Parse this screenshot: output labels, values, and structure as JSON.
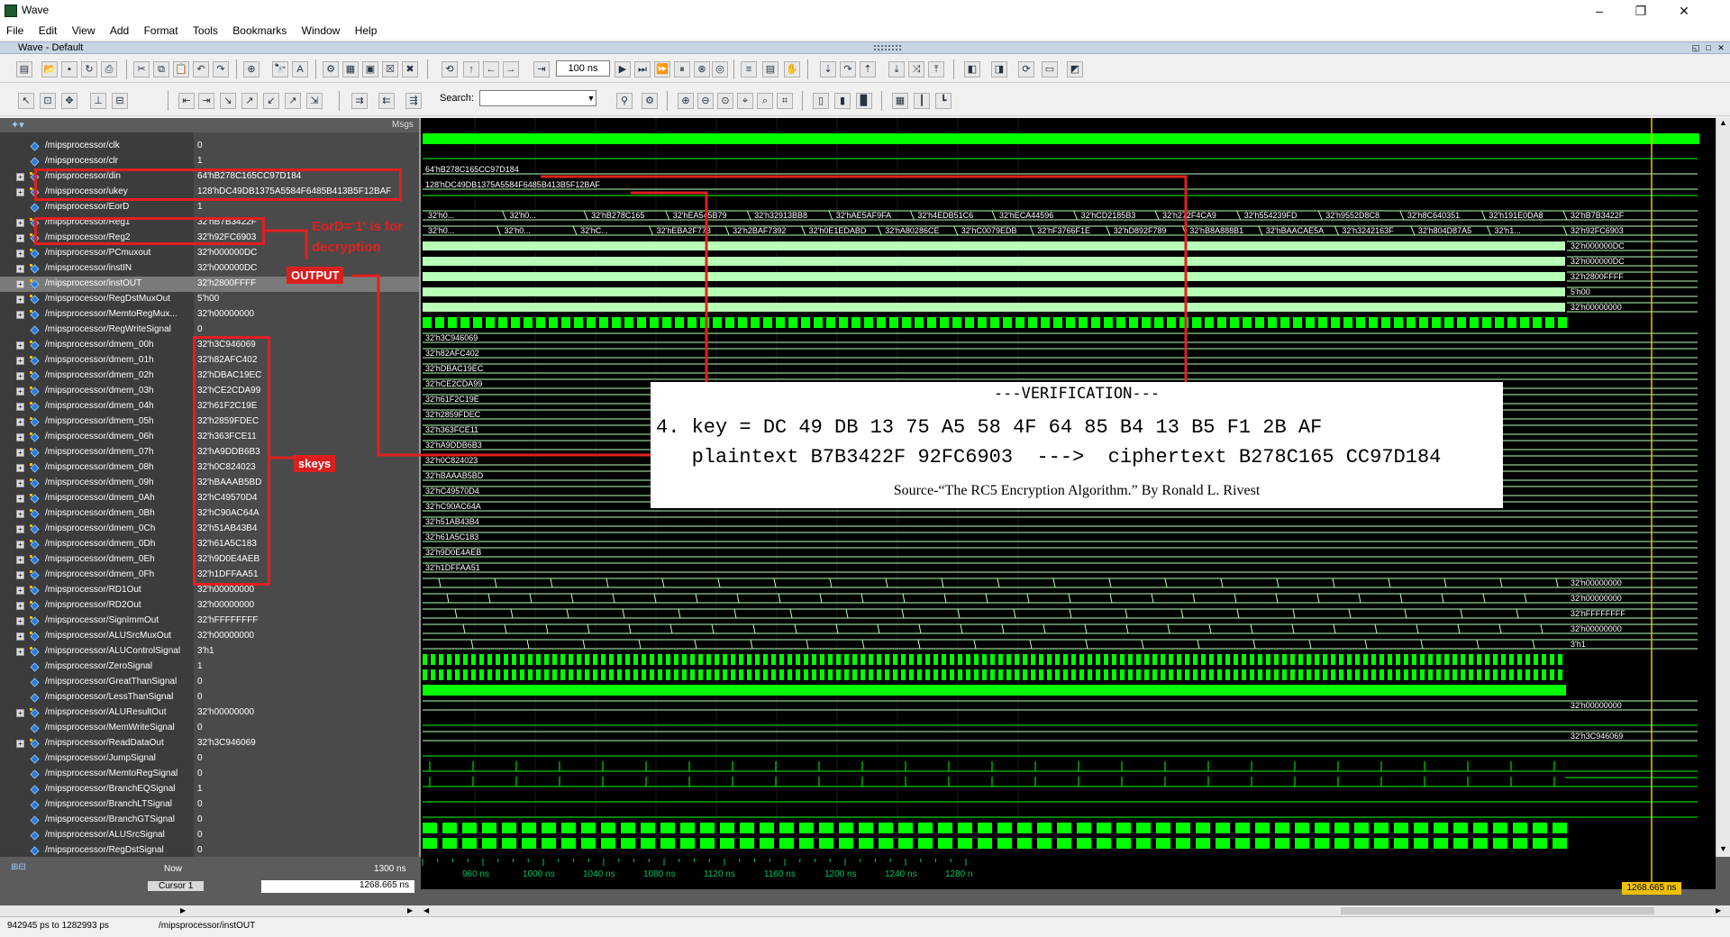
{
  "window": {
    "app_title": "Wave",
    "minimize": "–",
    "restore": "❐",
    "close": "✕"
  },
  "menu": [
    "File",
    "Edit",
    "View",
    "Add",
    "Format",
    "Tools",
    "Bookmarks",
    "Window",
    "Help"
  ],
  "pane": {
    "title": "Wave - Default",
    "msgs_label": "Msgs"
  },
  "toolbar": {
    "zoom_value": "100 ns",
    "search_label": "Search:",
    "search_value": ""
  },
  "signals": [
    {
      "name": "/mipsprocessor/clk",
      "value": "0",
      "expandable": false
    },
    {
      "name": "/mipsprocessor/clr",
      "value": "1",
      "expandable": false
    },
    {
      "name": "/mipsprocessor/din",
      "value": "64'hB278C165CC97D184",
      "expandable": true
    },
    {
      "name": "/mipsprocessor/ukey",
      "value": "128'hDC49DB1375A5584F6485B413B5F12BAF",
      "expandable": true
    },
    {
      "name": "/mipsprocessor/EorD",
      "value": "1",
      "expandable": false
    },
    {
      "name": "/mipsprocessor/Reg1",
      "value": "32'hB7B3422F",
      "expandable": true
    },
    {
      "name": "/mipsprocessor/Reg2",
      "value": "32'h92FC6903",
      "expandable": true
    },
    {
      "name": "/mipsprocessor/PCmuxout",
      "value": "32'h000000DC",
      "expandable": true
    },
    {
      "name": "/mipsprocessor/instIN",
      "value": "32'h000000DC",
      "expandable": true
    },
    {
      "name": "/mipsprocessor/instOUT",
      "value": "32'h2800FFFF",
      "expandable": true
    },
    {
      "name": "/mipsprocessor/RegDstMuxOut",
      "value": "5'h00",
      "expandable": true
    },
    {
      "name": "/mipsprocessor/MemtoRegMux...",
      "value": "32'h00000000",
      "expandable": true
    },
    {
      "name": "/mipsprocessor/RegWriteSignal",
      "value": "0",
      "expandable": false
    },
    {
      "name": "/mipsprocessor/dmem_00h",
      "value": "32'h3C946069",
      "expandable": true
    },
    {
      "name": "/mipsprocessor/dmem_01h",
      "value": "32'h82AFC402",
      "expandable": true
    },
    {
      "name": "/mipsprocessor/dmem_02h",
      "value": "32'hDBAC19EC",
      "expandable": true
    },
    {
      "name": "/mipsprocessor/dmem_03h",
      "value": "32'hCE2CDA99",
      "expandable": true
    },
    {
      "name": "/mipsprocessor/dmem_04h",
      "value": "32'h61F2C19E",
      "expandable": true
    },
    {
      "name": "/mipsprocessor/dmem_05h",
      "value": "32'h2859FDEC",
      "expandable": true
    },
    {
      "name": "/mipsprocessor/dmem_06h",
      "value": "32'h363FCE11",
      "expandable": true
    },
    {
      "name": "/mipsprocessor/dmem_07h",
      "value": "32'hA9DDB6B3",
      "expandable": true
    },
    {
      "name": "/mipsprocessor/dmem_08h",
      "value": "32'h0C824023",
      "expandable": true
    },
    {
      "name": "/mipsprocessor/dmem_09h",
      "value": "32'hBAAAB5BD",
      "expandable": true
    },
    {
      "name": "/mipsprocessor/dmem_0Ah",
      "value": "32'hC49570D4",
      "expandable": true
    },
    {
      "name": "/mipsprocessor/dmem_0Bh",
      "value": "32'hC90AC64A",
      "expandable": true
    },
    {
      "name": "/mipsprocessor/dmem_0Ch",
      "value": "32'h51AB43B4",
      "expandable": true
    },
    {
      "name": "/mipsprocessor/dmem_0Dh",
      "value": "32'h61A5C183",
      "expandable": true
    },
    {
      "name": "/mipsprocessor/dmem_0Eh",
      "value": "32'h9D0E4AEB",
      "expandable": true
    },
    {
      "name": "/mipsprocessor/dmem_0Fh",
      "value": "32'h1DFFAA51",
      "expandable": true
    },
    {
      "name": "/mipsprocessor/RD1Out",
      "value": "32'h00000000",
      "expandable": true
    },
    {
      "name": "/mipsprocessor/RD2Out",
      "value": "32'h00000000",
      "expandable": true
    },
    {
      "name": "/mipsprocessor/SignImmOut",
      "value": "32'hFFFFFFFF",
      "expandable": true
    },
    {
      "name": "/mipsprocessor/ALUSrcMuxOut",
      "value": "32'h00000000",
      "expandable": true
    },
    {
      "name": "/mipsprocessor/ALUControlSignal",
      "value": "3'h1",
      "expandable": true
    },
    {
      "name": "/mipsprocessor/ZeroSignal",
      "value": "1",
      "expandable": false
    },
    {
      "name": "/mipsprocessor/GreatThanSignal",
      "value": "0",
      "expandable": false
    },
    {
      "name": "/mipsprocessor/LessThanSignal",
      "value": "0",
      "expandable": false
    },
    {
      "name": "/mipsprocessor/ALUResultOut",
      "value": "32'h00000000",
      "expandable": true
    },
    {
      "name": "/mipsprocessor/MemWriteSignal",
      "value": "0",
      "expandable": false
    },
    {
      "name": "/mipsprocessor/ReadDataOut",
      "value": "32'h3C946069",
      "expandable": true
    },
    {
      "name": "/mipsprocessor/JumpSignal",
      "value": "0",
      "expandable": false
    },
    {
      "name": "/mipsprocessor/MemtoRegSignal",
      "value": "0",
      "expandable": false
    },
    {
      "name": "/mipsprocessor/BranchEQSignal",
      "value": "1",
      "expandable": false
    },
    {
      "name": "/mipsprocessor/BranchLTSignal",
      "value": "0",
      "expandable": false
    },
    {
      "name": "/mipsprocessor/BranchGTSignal",
      "value": "0",
      "expandable": false
    },
    {
      "name": "/mipsprocessor/ALUSrcSignal",
      "value": "0",
      "expandable": false
    },
    {
      "name": "/mipsprocessor/RegDstSignal",
      "value": "0",
      "expandable": false
    }
  ],
  "wave_labels": {
    "din": "64'hB278C165CC97D184",
    "ukey": "128'hDC49DB1375A5584F6485B413B5F12BAF",
    "reg1": [
      "32'h0...",
      "32'h0...",
      "32'hB278C165",
      "32'hEA545B79",
      "32'h32913BB8",
      "32'hAE5AF9FA",
      "32'h4EDB51C6",
      "32'hECA44596",
      "32'hCD2185B3",
      "32'h272F4CA9",
      "32'h554239FD",
      "32'h9552D8C8",
      "32'h8C640351",
      "32'h191E0DA8",
      "32'hB7B3422F"
    ],
    "reg2": [
      "32'h0...",
      "32'h0...",
      "32'hC...",
      "32'hEBA2F773",
      "32'h2BAF7392",
      "32'h0E1EDABD",
      "32'hA80286CE",
      "32'hC0079EDB",
      "32'hF3766F1E",
      "32'hD892F789",
      "32'hB8A888B1",
      "32'hBAACAE5A",
      "32'h3242163F",
      "32'h804D87A5",
      "32'h1...",
      "32'h92FC6903"
    ],
    "dmem_vals": [
      "32'h3C946069",
      "32'h82AFC402",
      "32'hDBAC19EC",
      "32'hCE2CDA99",
      "32'h61F2C19E",
      "32'h2859FDEC",
      "32'h363FCE11",
      "32'hA9DDB6B3",
      "32'h0C824023",
      "32'hBAAAB5BD",
      "32'hC49570D4",
      "32'hC90AC64A",
      "32'h51AB43B4",
      "32'h61A5C183",
      "32'h9D0E4AEB",
      "32'h1DFFAA51"
    ],
    "pcmux_end": "32'h000000DC",
    "instin_end": "32'h000000DC",
    "instout_end": "32'h2800FFFF",
    "regdst_end": "5'h00",
    "memtoreg_end": "32'h00000000",
    "rd1_end": "32'h00000000",
    "rd2_end": "32'h00000000",
    "signimm_end": "32'hFFFFFFFF",
    "alusrc_end": "32'h00000000",
    "aluctrl_end": "3'h1",
    "alures_end": "32'h00000000",
    "readdata_end": "32'h3C946069"
  },
  "annotations": {
    "eord_label_1": "EorD='1' is for",
    "eord_label_2": "decryption",
    "output_label": "OUTPUT",
    "skeys_label": "skeys"
  },
  "verification": {
    "title": "---VERIFICATION---",
    "key_line": "4. key = DC 49 DB 13 75 A5 58 4F 64 85 B4 13 B5 F1 2B AF",
    "plain_line": "   plaintext B7B3422F 92FC6903  --->  ciphertext B278C165 CC97D184",
    "source": "Source-“The RC5 Encryption Algorithm.” By Ronald L. Rivest"
  },
  "timebar": {
    "now_label": "Now",
    "now_value": "1300 ns",
    "cursor_label": "Cursor 1",
    "cursor_value": "1268.665 ns",
    "cursor_flag": "1268.665 ns",
    "ticks": [
      "960 ns",
      "1000 ns",
      "1040 ns",
      "1080 ns",
      "1120 ns",
      "1160 ns",
      "1200 ns",
      "1240 ns",
      "1280 n"
    ]
  },
  "status": {
    "range": "942945 ps to 1282993 ps",
    "selected": "/mipsprocessor/instOUT"
  },
  "colors": {
    "wave_bright": "#00ff00",
    "wave_bus": "#b8ffb8",
    "annotation": "#e02020",
    "cursor": "#f0c000"
  }
}
